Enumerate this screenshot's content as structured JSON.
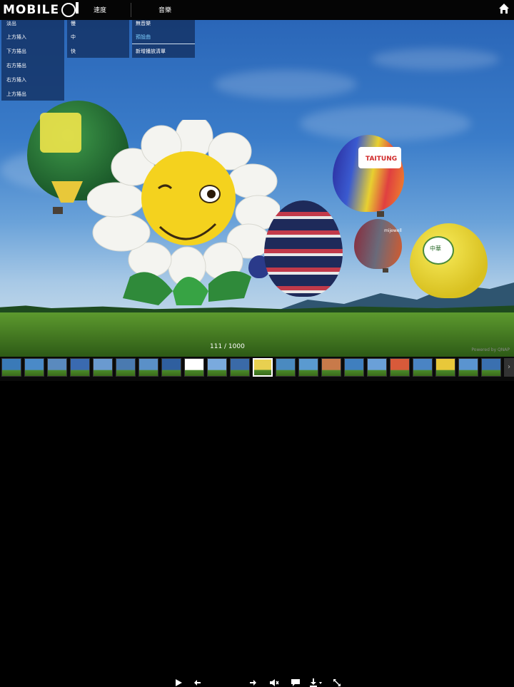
{
  "header": {
    "logo_text": "MOBILE",
    "speed_label": "速度",
    "music_label": "音樂"
  },
  "transition_menu": [
    "淡出",
    "上方捲入",
    "下方捲出",
    "右方捲出",
    "右方捲入",
    "上方捲出"
  ],
  "speed_menu": [
    "慢",
    "中",
    "快"
  ],
  "music_menu": {
    "items": [
      "無音樂",
      "預設曲",
      "新增播放清單"
    ],
    "selected_index": 1
  },
  "controls": {
    "counter": "111 / 1000",
    "powered_by": "Powered by QNAP"
  },
  "balloons": {
    "taitung_text": "TAITUNG",
    "brand_text": "mijewell",
    "yellow_text": "中華"
  },
  "filmstrip": {
    "count": 22,
    "selected_index": 11
  }
}
